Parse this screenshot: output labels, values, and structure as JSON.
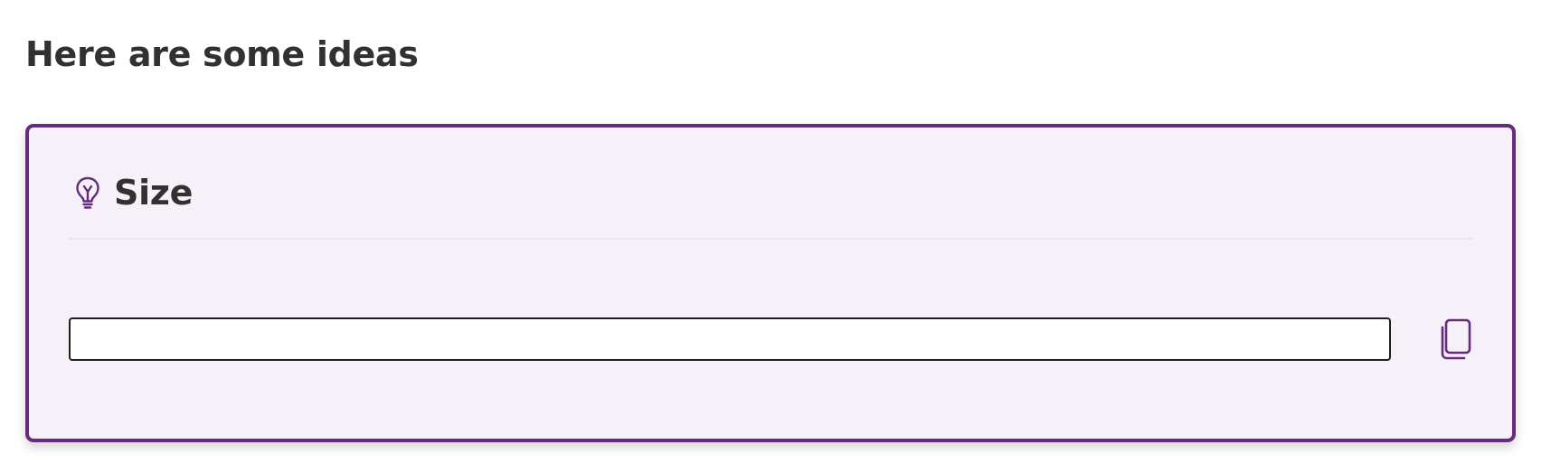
{
  "page": {
    "heading": "Here are some ideas"
  },
  "card": {
    "title": "Size",
    "title_icon": "lightbulb-icon",
    "field": {
      "value": "",
      "placeholder": ""
    },
    "copy_icon": "copy-icon"
  },
  "colors": {
    "accent": "#662b7c",
    "card_background": "#f6f1f9",
    "text": "#323130",
    "field_border": "#201f1e"
  }
}
